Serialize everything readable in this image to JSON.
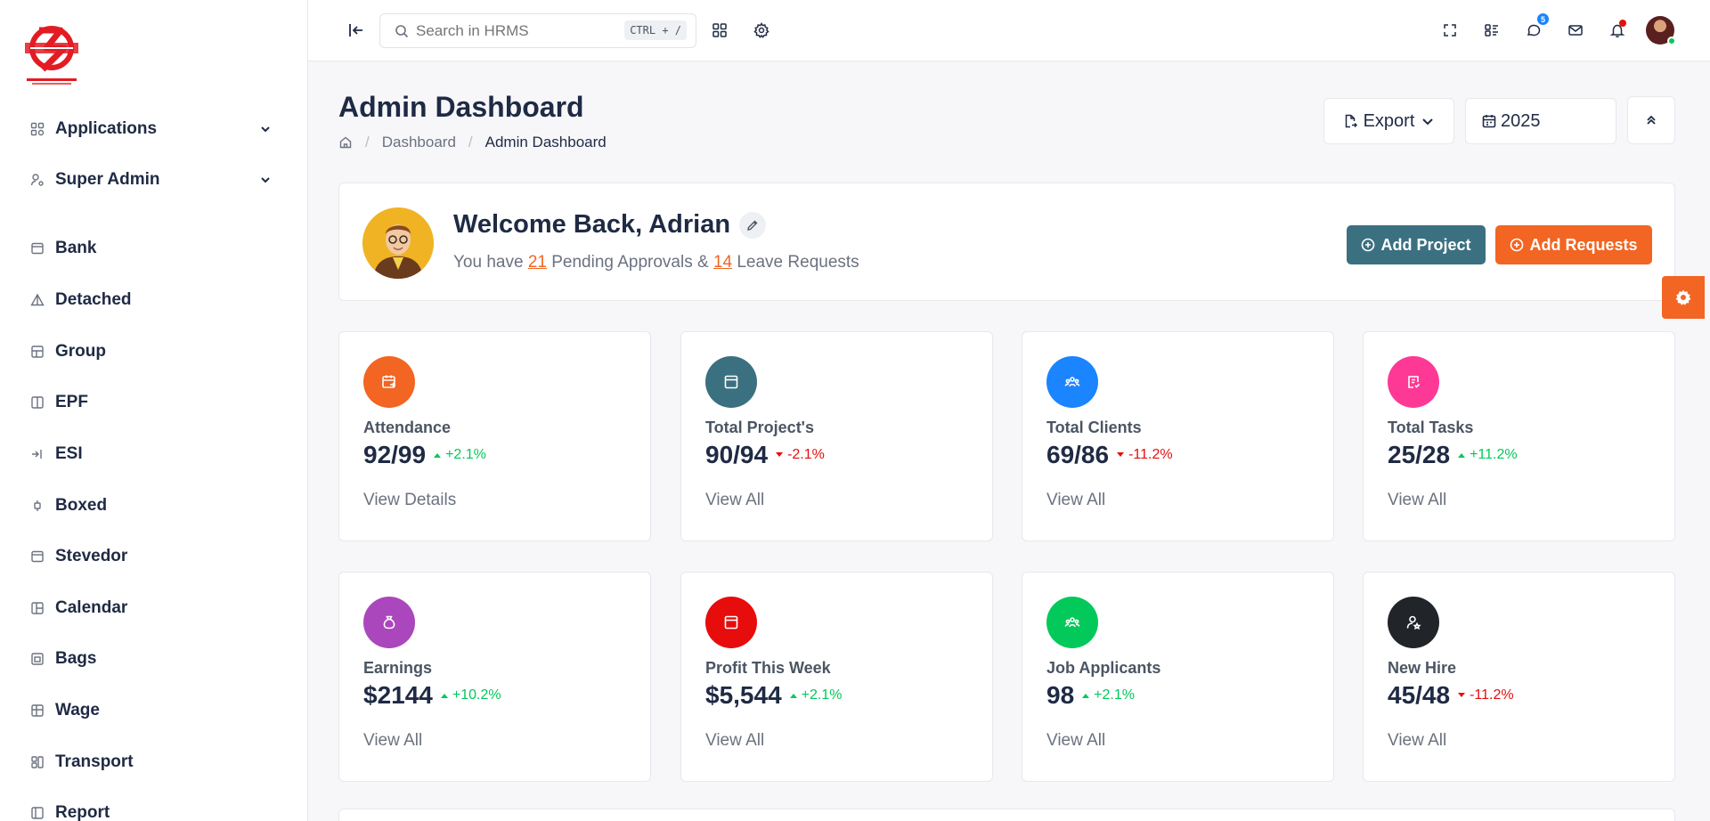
{
  "header": {
    "search_placeholder": "Search in HRMS",
    "shortcut": "CTRL + /",
    "chat_badge": "5"
  },
  "sidebar": {
    "items": [
      {
        "label": "Applications",
        "icon": "grid-icon"
      },
      {
        "label": "Super Admin",
        "icon": "user-cog-icon"
      },
      {
        "label": "Bank",
        "icon": "calendar-icon"
      },
      {
        "label": "Detached",
        "icon": "triangle-icon"
      },
      {
        "label": "Group",
        "icon": "table-icon"
      },
      {
        "label": "EPF",
        "icon": "columns-icon"
      },
      {
        "label": "ESI",
        "icon": "arrow-right-bar-icon"
      },
      {
        "label": "Boxed",
        "icon": "box-icon"
      },
      {
        "label": "Stevedor",
        "icon": "window-icon"
      },
      {
        "label": "Calendar",
        "icon": "layout-icon"
      },
      {
        "label": "Bags",
        "icon": "bag-icon"
      },
      {
        "label": "Wage",
        "icon": "table-icon"
      },
      {
        "label": "Transport",
        "icon": "transport-icon"
      },
      {
        "label": "Report",
        "icon": "report-icon"
      }
    ]
  },
  "page": {
    "title": "Admin Dashboard",
    "breadcrumb": [
      "Dashboard",
      "Admin Dashboard"
    ],
    "export_label": "Export",
    "year": "2025"
  },
  "welcome": {
    "title": "Welcome Back, Adrian",
    "sub_prefix": "You have",
    "pending_count": "21",
    "sub_mid": "Pending Approvals &",
    "leave_count": "14",
    "sub_suffix": "Leave Requests",
    "add_project": "Add Project",
    "add_requests": "Add Requests"
  },
  "stats": [
    {
      "label": "Attendance",
      "value": "92/99",
      "change": "+2.1%",
      "trend": "up",
      "link": "View Details",
      "color": "#f26522",
      "icon": "calendar-share-icon"
    },
    {
      "label": "Total Project's",
      "value": "90/94",
      "change": "-2.1%",
      "trend": "down",
      "link": "View All",
      "color": "#3b7080",
      "icon": "browser-icon"
    },
    {
      "label": "Total Clients",
      "value": "69/86",
      "change": "-11.2%",
      "trend": "down",
      "link": "View All",
      "color": "#1b84ff",
      "icon": "users-group-icon"
    },
    {
      "label": "Total Tasks",
      "value": "25/28",
      "change": "+11.2%",
      "trend": "up",
      "link": "View All",
      "color": "#fd3995",
      "icon": "checklist-icon"
    },
    {
      "label": "Earnings",
      "value": "$2144",
      "change": "+10.2%",
      "trend": "up",
      "link": "View All",
      "color": "#ab47bc",
      "icon": "money-bag-icon"
    },
    {
      "label": "Profit This Week",
      "value": "$5,544",
      "change": "+2.1%",
      "trend": "up",
      "link": "View All",
      "color": "#e70d0d",
      "icon": "browser-icon"
    },
    {
      "label": "Job Applicants",
      "value": "98",
      "change": "+2.1%",
      "trend": "up",
      "link": "View All",
      "color": "#03c95a",
      "icon": "users-group-icon"
    },
    {
      "label": "New Hire",
      "value": "45/48",
      "change": "-11.2%",
      "trend": "down",
      "link": "View All",
      "color": "#212529",
      "icon": "user-star-icon"
    }
  ]
}
